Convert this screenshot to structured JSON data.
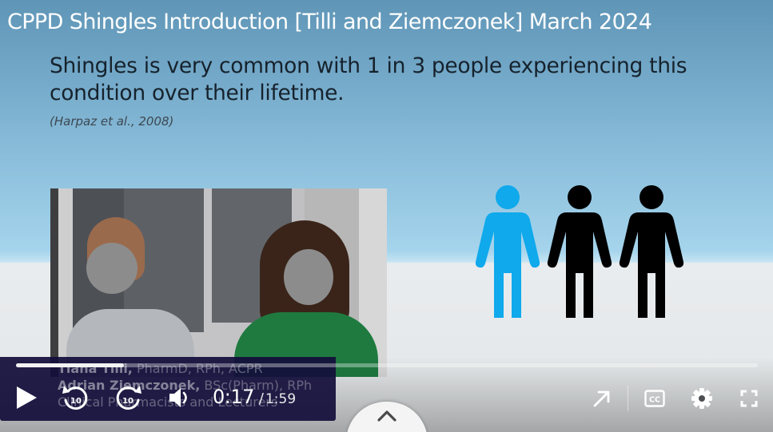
{
  "video": {
    "title": "CPPD Shingles Introduction [Tilli and Ziemczonek] March 2024"
  },
  "slide": {
    "heading": "Shingles is very common with 1 in 3 people experiencing this condition over their lifetime.",
    "citation": "(Harpaz et al., 2008)",
    "figures": {
      "total": 3,
      "highlighted": 1,
      "highlight_color": "#0fa9ec",
      "default_color": "#000000",
      "icon": "person-icon"
    }
  },
  "lower_third": {
    "line1_name": "Tiana Tilli,",
    "line1_credentials": " PharmD, RPh, ACPR",
    "line2_name": "Adrian Ziemczonek,",
    "line2_credentials": " BSc(Pharm), RPh",
    "line3": "Clinical Pharmacists and Lecturers"
  },
  "player": {
    "progress_fraction": 0.145,
    "current_time": "0:17",
    "separator": "/",
    "duration": "1:59",
    "icons": {
      "play": "play-icon",
      "rewind": "rewind-10-icon",
      "forward": "forward-10-icon",
      "volume": "volume-icon",
      "share": "share-arrow-icon",
      "captions": "closed-captions-icon",
      "settings": "gear-icon",
      "fullscreen": "fullscreen-icon",
      "expand": "chevron-up-icon"
    },
    "accent_color": "#150f3c"
  }
}
